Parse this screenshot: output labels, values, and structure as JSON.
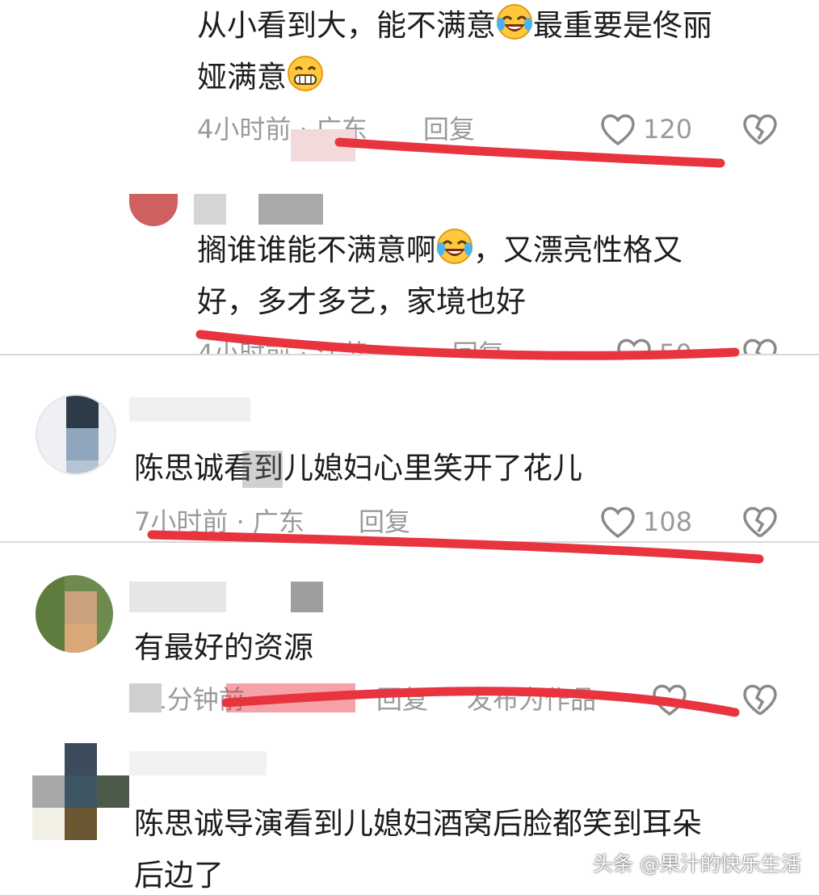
{
  "comments": [
    {
      "text_line1": "从小看到大，能不满意",
      "text_line1b": "最重要是佟丽",
      "text_line2": "娅满意",
      "meta": "4小时前 · 广东",
      "reply": "回复",
      "likes": "120"
    },
    {
      "text_line1": "搁谁谁能不满意啊",
      "text_line1b": "，又漂亮性格又",
      "text_line2": "好，多才多艺，家境也好",
      "meta": "4小时前 · 江苏",
      "reply": "回复",
      "likes": "50"
    },
    {
      "text": "陈思诚看到儿媳妇心里笑开了花儿",
      "meta": "7小时前 · 广东",
      "reply": "回复",
      "likes": "108"
    },
    {
      "text": "有最好的资源",
      "meta": "21分钟前",
      "reply": "回复",
      "publish": "发布为作品"
    },
    {
      "text_line1": "陈思诚导演看到儿媳妇酒窝后脸都笑到耳朵",
      "text_line2": "后边了"
    }
  ],
  "watermark": "头条 @果汁的快乐生活",
  "colors": {
    "red_mark": "#e8343f",
    "meta_gray": "#9a9a9a"
  },
  "icons": [
    "heart-outline-icon",
    "broken-heart-icon",
    "laughing-tears-emoji",
    "grinning-emoji"
  ]
}
